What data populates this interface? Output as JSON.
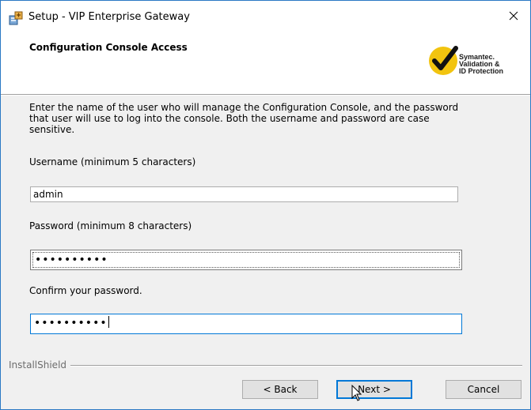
{
  "window": {
    "title": "Setup - VIP Enterprise Gateway",
    "close_glyph": "✕"
  },
  "header": {
    "title": "Configuration Console Access",
    "brand": {
      "line1": "Symantec.",
      "line2": "Validation &",
      "line3": "ID Protection",
      "check_color": "#f2c40f",
      "check_mark_color": "#111111"
    }
  },
  "content": {
    "description": "Enter the name of the user who will manage the Configuration Console, and the password that user will use to log into the console. Both the username and password are case sensitive.",
    "username_label": "Username (minimum 5 characters)",
    "username_value": "admin",
    "password_label": "Password (minimum 8 characters)",
    "password_value": "••••••••••",
    "confirm_label": "Confirm your password.",
    "confirm_value": "••••••••••"
  },
  "footer": {
    "installshield_label": "InstallShield",
    "back_label": "< Back",
    "next_label": "Next >",
    "cancel_label": "Cancel"
  },
  "colors": {
    "focus_border": "#0078d7",
    "window_border": "#2a78c4"
  },
  "icons": [
    "setup-app-icon",
    "close-icon",
    "symantec-check-icon",
    "mouse-pointer-icon"
  ]
}
